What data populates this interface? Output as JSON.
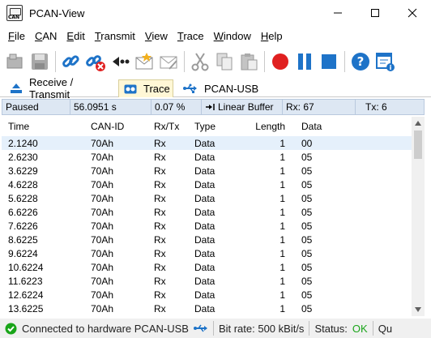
{
  "window": {
    "title": "PCAN-View"
  },
  "menu": [
    "File",
    "CAN",
    "Edit",
    "Transmit",
    "View",
    "Trace",
    "Window",
    "Help"
  ],
  "menu_accel": [
    "F",
    "C",
    "E",
    "T",
    "V",
    "T",
    "W",
    "H"
  ],
  "toolbar": {
    "buttons": [
      "connect-icon",
      "save-icon",
      "connect-link-icon",
      "disconnect-link-icon",
      "reset-icon",
      "new-message-icon",
      "edit-message-icon",
      "cut-icon",
      "copy-icon",
      "paste-icon",
      "record-icon",
      "pause-icon",
      "stop-icon",
      "help-icon",
      "settings-window-icon"
    ]
  },
  "tabs": [
    {
      "label": "Receive / Transmit",
      "active": false
    },
    {
      "label": "Trace",
      "active": true
    },
    {
      "label": "PCAN-USB",
      "active": false
    }
  ],
  "trace_status": {
    "state": "Paused",
    "duration": "56.0951 s",
    "buffer_pct": "0.07 %",
    "buffer_mode": "Linear Buffer",
    "rx": "Rx: 67",
    "tx": "Tx: 6"
  },
  "columns": {
    "time": "Time",
    "canid": "CAN-ID",
    "rxtx": "Rx/Tx",
    "type": "Type",
    "length": "Length",
    "data": "Data"
  },
  "rows": [
    {
      "time": "2.1240",
      "canid": "70Ah",
      "rxtx": "Rx",
      "type": "Data",
      "length": "1",
      "data": "00"
    },
    {
      "time": "2.6230",
      "canid": "70Ah",
      "rxtx": "Rx",
      "type": "Data",
      "length": "1",
      "data": "05"
    },
    {
      "time": "3.6229",
      "canid": "70Ah",
      "rxtx": "Rx",
      "type": "Data",
      "length": "1",
      "data": "05"
    },
    {
      "time": "4.6228",
      "canid": "70Ah",
      "rxtx": "Rx",
      "type": "Data",
      "length": "1",
      "data": "05"
    },
    {
      "time": "5.6228",
      "canid": "70Ah",
      "rxtx": "Rx",
      "type": "Data",
      "length": "1",
      "data": "05"
    },
    {
      "time": "6.6226",
      "canid": "70Ah",
      "rxtx": "Rx",
      "type": "Data",
      "length": "1",
      "data": "05"
    },
    {
      "time": "7.6226",
      "canid": "70Ah",
      "rxtx": "Rx",
      "type": "Data",
      "length": "1",
      "data": "05"
    },
    {
      "time": "8.6225",
      "canid": "70Ah",
      "rxtx": "Rx",
      "type": "Data",
      "length": "1",
      "data": "05"
    },
    {
      "time": "9.6224",
      "canid": "70Ah",
      "rxtx": "Rx",
      "type": "Data",
      "length": "1",
      "data": "05"
    },
    {
      "time": "10.6224",
      "canid": "70Ah",
      "rxtx": "Rx",
      "type": "Data",
      "length": "1",
      "data": "05"
    },
    {
      "time": "11.6223",
      "canid": "70Ah",
      "rxtx": "Rx",
      "type": "Data",
      "length": "1",
      "data": "05"
    },
    {
      "time": "12.6224",
      "canid": "70Ah",
      "rxtx": "Rx",
      "type": "Data",
      "length": "1",
      "data": "05"
    },
    {
      "time": "13.6225",
      "canid": "70Ah",
      "rxtx": "Rx",
      "type": "Data",
      "length": "1",
      "data": "05"
    }
  ],
  "statusbar": {
    "connection": "Connected to hardware PCAN-USB",
    "bitrate": "Bit rate: 500 kBit/s",
    "status_label": "Status:",
    "status_value": "OK",
    "overflow": "Qu"
  },
  "colors": {
    "accent_blue": "#1e73c8",
    "record_red": "#e02020",
    "ok_green": "#1aa51a"
  }
}
